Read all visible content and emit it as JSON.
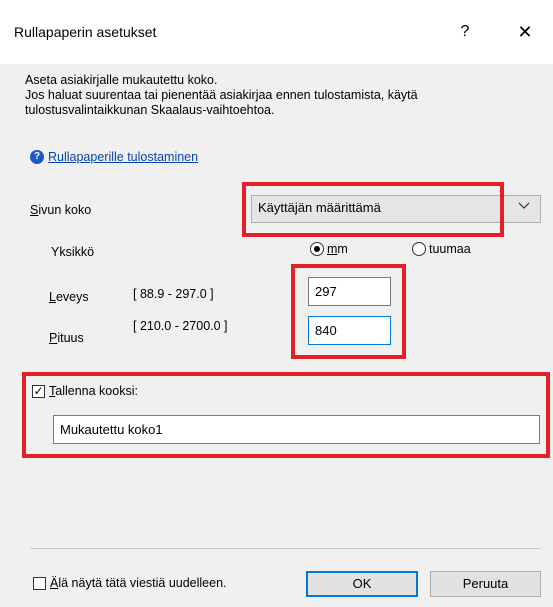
{
  "window": {
    "title": "Rullapaperin asetukset",
    "help_glyph": "?",
    "close_glyph": "✕"
  },
  "description": {
    "line1": "Aseta asiakirjalle mukautettu koko.",
    "line2": "Jos haluat suurentaa tai pienentää asiakirjaa ennen tulostamista, käytä",
    "line3": "tulostusvalintaikkunan Skaalaus-vaihtoehtoa."
  },
  "help_link": {
    "label": "Rullapaperille tulostaminen"
  },
  "page_size": {
    "label": "Sivun koko",
    "selected": "Käyttäjän määrittämä"
  },
  "unit": {
    "label": "Yksikkö",
    "options": [
      {
        "label": "mm",
        "selected": true
      },
      {
        "label": "tuumaa",
        "selected": false
      }
    ]
  },
  "width": {
    "label": "Leveys",
    "range": "[ 88.9 - 297.0 ]",
    "value": "297"
  },
  "length": {
    "label": "Pituus",
    "range": "[ 210.0 - 2700.0 ]",
    "value": "840"
  },
  "save_as": {
    "label": "Tallenna kooksi:",
    "checked": true,
    "value": "Mukautettu koko1"
  },
  "footer": {
    "dont_show_label": "Älä näytä tätä viestiä uudelleen.",
    "ok_label": "OK",
    "cancel_label": "Peruuta"
  },
  "colors": {
    "highlight": "#e3202a",
    "link": "#0645ad",
    "focus": "#0078d7"
  }
}
